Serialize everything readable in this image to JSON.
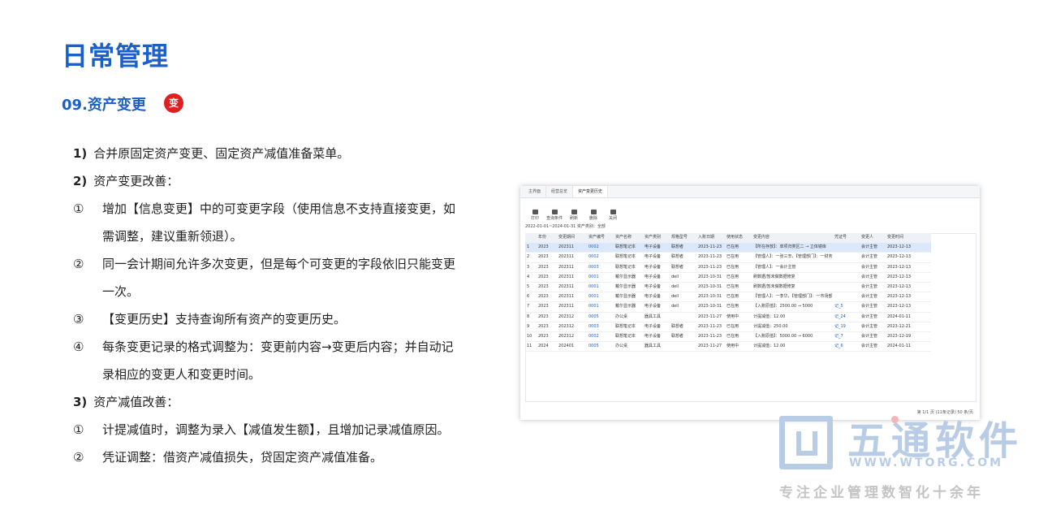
{
  "title": "日常管理",
  "subtitle": "09.资产变更",
  "badge": "变",
  "points": {
    "p1": {
      "num": "1)",
      "text": "合并原固定资产变更、固定资产减值准备菜单。"
    },
    "p2": {
      "num": "2)",
      "text": "资产变更改善："
    },
    "p2_items": [
      {
        "mark": "①",
        "text": "增加【信息变更】中的可变更字段（使用信息不支持直接变更，如需调整，建议重新领退）。"
      },
      {
        "mark": "②",
        "text": "同一会计期间允许多次变更，但是每个可变更的字段依旧只能变更一次。"
      },
      {
        "mark": "③",
        "text": "【变更历史】支持查询所有资产的变更历史。"
      },
      {
        "mark": "④",
        "text": "每条变更记录的格式调整为：变更前内容→变更后内容；并自动记录相应的变更人和变更时间。"
      }
    ],
    "p3": {
      "num": "3)",
      "text": "资产减值改善："
    },
    "p3_items": [
      {
        "mark": "①",
        "text": "计提减值时，调整为录入【减值发生额】，且增加记录减值原因。"
      },
      {
        "mark": "②",
        "text": "凭证调整：借资产减值损失，贷固定资产减值准备。"
      }
    ]
  },
  "screenshot": {
    "tabs": [
      "主界面",
      "经营总览",
      "资产变更历史"
    ],
    "toolbar": [
      "打印",
      "查询条件",
      "刷新",
      "删除",
      "关闭"
    ],
    "filter": "2022-01-01~2024-01-31  资产类别：全部",
    "columns": [
      "",
      "年份",
      "变更期间",
      "资产编号",
      "资产名称",
      "资产类别",
      "规格型号",
      "入账日期",
      "使用状态",
      "变更内容",
      "凭证号",
      "变更人",
      "变更时间"
    ],
    "rows": [
      [
        "1",
        "2023",
        "202311",
        "0002",
        "联想笔记本",
        "电子设备",
        "联想者",
        "2023-11-23",
        "已在用",
        "【所在存放】：单项归类区二 → 立体镜库",
        "",
        "会计主管",
        "2023-12-13"
      ],
      [
        "2",
        "2023",
        "202311",
        "0002",
        "联想笔记本",
        "电子设备",
        "联想者",
        "2023-11-23",
        "已在用",
        "【管理人】：一张三辛，【管理部门】：一财务部",
        "",
        "会计主管",
        "2023-12-13"
      ],
      [
        "3",
        "2023",
        "202311",
        "0003",
        "联想笔记本",
        "电子设备",
        "联想者",
        "2023-11-23",
        "已在用",
        "【管理人】：一会计主管",
        "",
        "会计主管",
        "2023-12-13"
      ],
      [
        "4",
        "2023",
        "202311",
        "0001",
        "戴尔显示器",
        "电子设备",
        "dell",
        "2023-10-31",
        "已在用",
        "刷数据/暂未做数据修复",
        "",
        "会计主管",
        "2023-12-13"
      ],
      [
        "5",
        "2023",
        "202311",
        "0001",
        "戴尔显示器",
        "电子设备",
        "dell",
        "2023-10-31",
        "已在用",
        "刷数据/暂未做数据修复",
        "",
        "会计主管",
        "2023-12-13"
      ],
      [
        "6",
        "2023",
        "202311",
        "0001",
        "戴尔显示器",
        "电子设备",
        "dell",
        "2023-10-31",
        "已在用",
        "【管理人】：一李华，【管理部门】：一市场部",
        "",
        "会计主管",
        "2023-12-13"
      ],
      [
        "7",
        "2023",
        "202311",
        "0001",
        "戴尔显示器",
        "电子设备",
        "dell",
        "2023-10-31",
        "已在用",
        "【入账原值】：2500.00 → 5000",
        "记_5",
        "会计主管",
        "2023-12-13"
      ],
      [
        "8",
        "2023",
        "202312",
        "0005",
        "办公桌",
        "器具工具",
        "",
        "2023-11-27",
        "使用中",
        "计提减值：12.00",
        "记_24",
        "会计主管",
        "2024-01-11"
      ],
      [
        "9",
        "2023",
        "202312",
        "0003",
        "联想笔记本",
        "电子设备",
        "联想者",
        "2023-11-23",
        "已在用",
        "计提减值：250.00",
        "记_19",
        "会计主管",
        "2023-12-21"
      ],
      [
        "10",
        "2023",
        "202312",
        "0002",
        "联想笔记本",
        "电子设备",
        "联想者",
        "2023-11-23",
        "已在用",
        "【入账原值】：5000.00 → 6000",
        "记_7",
        "会计主管",
        "2023-12-19"
      ],
      [
        "11",
        "2024",
        "202401",
        "0005",
        "办公桌",
        "器具工具",
        "",
        "2023-11-27",
        "使用中",
        "计提减值：12.00",
        "记_6",
        "会计主管",
        "2024-01-11"
      ]
    ],
    "pager": "第 1/1 页 (11条记录)  50  条/页"
  },
  "logo": {
    "name": "五通软件",
    "url": "WWW.WTORG.COM",
    "slogan": "专注企业管理数智化十余年"
  }
}
